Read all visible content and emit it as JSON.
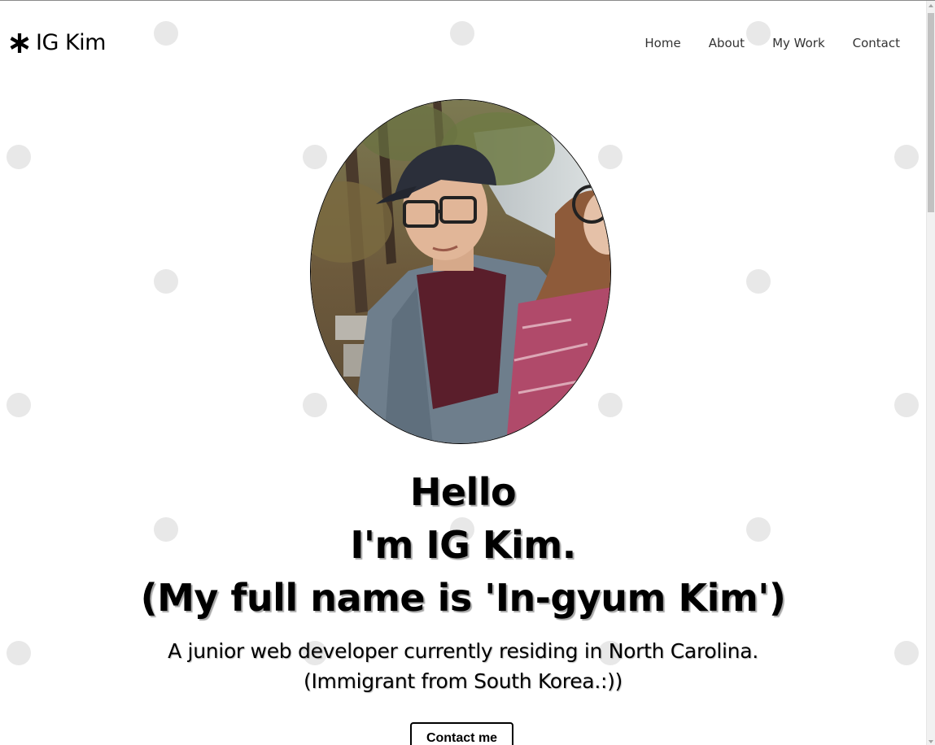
{
  "navbar": {
    "brand": "IG Kim",
    "links": [
      "Home",
      "About",
      "My Work",
      "Contact"
    ]
  },
  "hero": {
    "title_lines": [
      "Hello",
      "I'm IG Kim.",
      "(My full name is 'In-gyum Kim')"
    ],
    "subtitle_lines": [
      "A junior web developer currently residing in North Carolina.",
      "(Immigrant from South Korea.:))"
    ],
    "button_label": "Contact me"
  },
  "icons": {
    "brand": "asterisk-icon"
  },
  "colors": {
    "background": "#ffffff",
    "dot": "#e8e8e8",
    "text": "#000000",
    "nav_text": "#333333"
  }
}
